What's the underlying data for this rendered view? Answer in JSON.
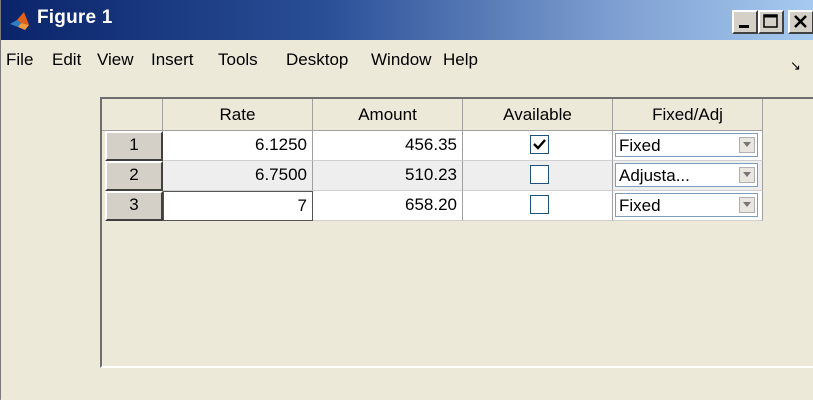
{
  "window": {
    "title": "Figure 1",
    "colors": {
      "title_start": "#0a246a",
      "title_end": "#a6caf0",
      "face": "#ece9d8"
    }
  },
  "menu": {
    "items": [
      "File",
      "Edit",
      "View",
      "Insert",
      "Tools",
      "Desktop",
      "Window",
      "Help"
    ],
    "dock_glyph": "↘"
  },
  "table": {
    "columns": [
      "Rate",
      "Amount",
      "Available",
      "Fixed/Adj"
    ],
    "rows": [
      {
        "row_header": "1",
        "rate": "6.1250",
        "amount": "456.35",
        "available": true,
        "fixed_adj": "Fixed"
      },
      {
        "row_header": "2",
        "rate": "6.7500",
        "amount": "510.23",
        "available": false,
        "fixed_adj": "Adjusta..."
      },
      {
        "row_header": "3",
        "rate": "7",
        "amount": "658.20",
        "available": false,
        "fixed_adj": "Fixed"
      }
    ]
  },
  "icons": {
    "app": "matlab-logo-icon",
    "minimize": "minimize-icon",
    "maximize": "maximize-icon",
    "close": "close-icon",
    "checkbox_check": "checkmark-icon",
    "dropdown": "chevron-down-icon"
  }
}
